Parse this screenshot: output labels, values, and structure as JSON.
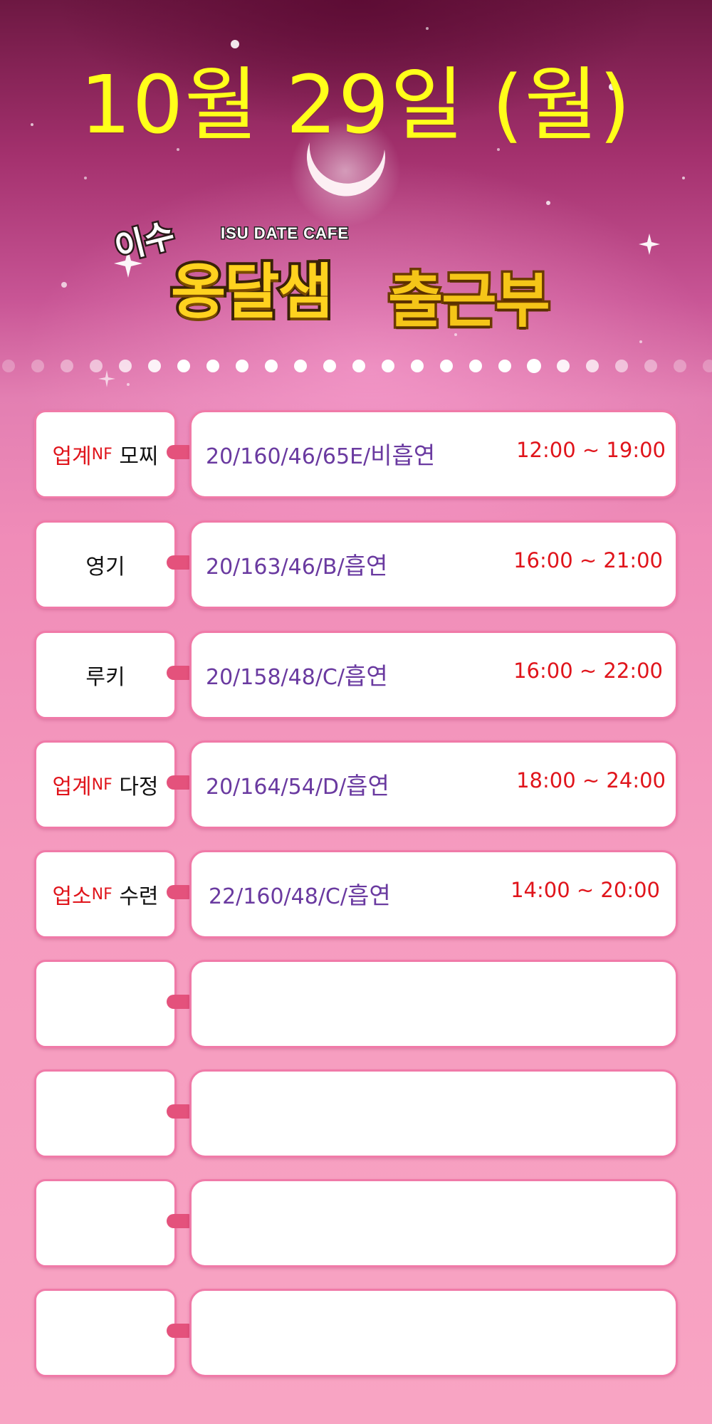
{
  "title": "10월 29일 (월)",
  "logo": {
    "isu": "이수",
    "subtitle": "ISU DATE CAFE",
    "name": "옹달샘",
    "label": "출근부"
  },
  "schedule": [
    {
      "tag": "업계",
      "nf": "NF",
      "name": "모찌",
      "spec_num": "20/160/46/65E/",
      "spec_kor": "비흡연",
      "time": "12:00 ~ 19:00"
    },
    {
      "tag": "",
      "nf": "",
      "name": "영기",
      "spec_num": "20/163/46/B/",
      "spec_kor": "흡연",
      "time": "16:00 ~ 21:00"
    },
    {
      "tag": "",
      "nf": "",
      "name": "루키",
      "spec_num": "20/158/48/C/",
      "spec_kor": "흡연",
      "time": "16:00 ~ 22:00"
    },
    {
      "tag": "업계",
      "nf": "NF",
      "name": "다정",
      "spec_num": "20/164/54/D/",
      "spec_kor": "흡연",
      "time": "18:00 ~ 24:00"
    },
    {
      "tag": "업소",
      "nf": "NF",
      "name": "수련",
      "spec_num": "22/160/48/C/",
      "spec_kor": "흡연",
      "time": "14:00 ~ 20:00"
    },
    {
      "tag": "",
      "nf": "",
      "name": "",
      "spec_num": "",
      "spec_kor": "",
      "time": ""
    },
    {
      "tag": "",
      "nf": "",
      "name": "",
      "spec_num": "",
      "spec_kor": "",
      "time": ""
    },
    {
      "tag": "",
      "nf": "",
      "name": "",
      "spec_num": "",
      "spec_kor": "",
      "time": ""
    },
    {
      "tag": "",
      "nf": "",
      "name": "",
      "spec_num": "",
      "spec_kor": "",
      "time": ""
    }
  ],
  "colors": {
    "title": "#ffff1a",
    "tag": "#e0141b",
    "spec": "#6a3aa0",
    "time": "#e0141b",
    "connector": "#e4527c",
    "box_border": "#f07aa8"
  }
}
